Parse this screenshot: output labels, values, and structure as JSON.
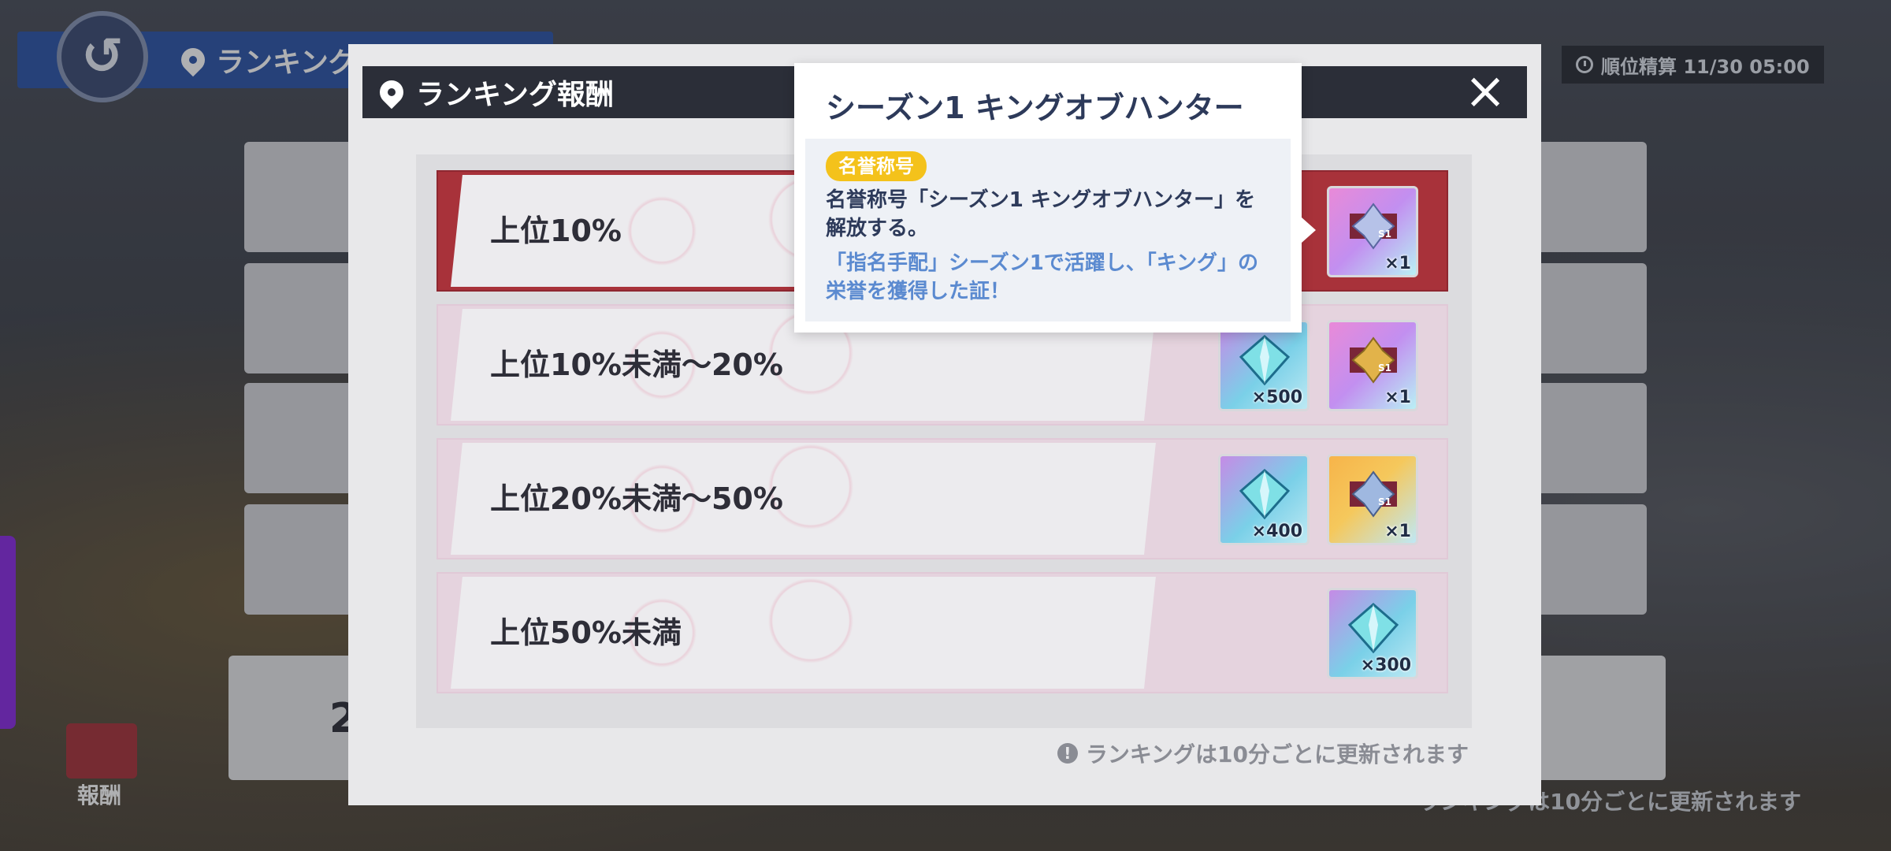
{
  "background": {
    "page_title": "ランキング",
    "timer": "順位精算 11/30 05:00",
    "gift_label": "報酬",
    "footer_note": "ランキングは10分ごとに更新されます",
    "rank_partial": "2"
  },
  "modal": {
    "title": "ランキング報酬",
    "close_icon": "×",
    "footer_note": "ランキングは10分ごとに更新されます",
    "tiers": [
      {
        "label": "上位10%",
        "items": [
          {
            "kind": "badge-purple",
            "qty": "×1"
          }
        ]
      },
      {
        "label": "上位10%未満～20%",
        "items": [
          {
            "kind": "crystal",
            "qty": "×500"
          },
          {
            "kind": "badge-purple",
            "qty": "×1"
          }
        ]
      },
      {
        "label": "上位20%未満～50%",
        "items": [
          {
            "kind": "crystal",
            "qty": "×400"
          },
          {
            "kind": "badge-gold",
            "qty": "×1"
          }
        ]
      },
      {
        "label": "上位50%未満",
        "items": [
          {
            "kind": "crystal",
            "qty": "×300"
          }
        ]
      }
    ]
  },
  "tooltip": {
    "title": "シーズン1 キングオブハンター",
    "tag": "名誉称号",
    "description": "名誉称号「シーズン1 キングオブハンター」を解放する。",
    "flavor": "「指名手配」シーズン1で活躍し、「キング」の栄誉を獲得した証！"
  },
  "colors": {
    "accent_red": "#a8323a",
    "tag_yellow": "#f4c21b",
    "header_dark": "#2b2e38",
    "flavor_blue": "#5b8ad0"
  }
}
